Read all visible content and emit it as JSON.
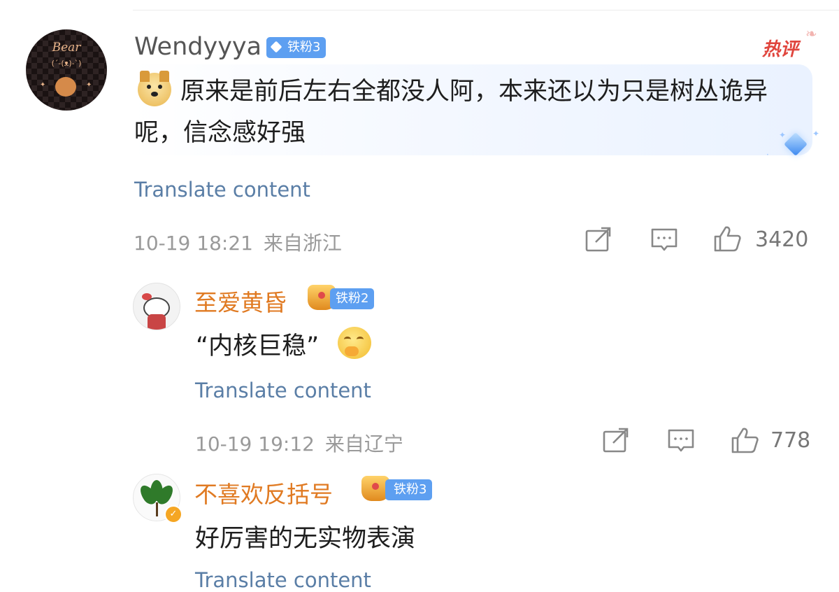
{
  "main_comment": {
    "username": "Wendyyya",
    "fan_badge": "铁粉3",
    "hot_badge": "热评",
    "text": "原来是前后左右全都没人阿，本来还以为只是树丛诡异呢，信念感好强",
    "translate_label": "Translate content",
    "timestamp": "10-19 18:21",
    "location": "来自浙江",
    "like_count": "3420",
    "avatar_text": "Bear",
    "avatar_face": "(´-(ᴥ)-`)"
  },
  "replies": [
    {
      "username": "至爱黄昏",
      "fan_badge": "铁粉2",
      "text": "“内核巨稳”",
      "translate_label": "Translate content",
      "timestamp": "10-19 19:12",
      "location": "来自辽宁",
      "like_count": "778"
    },
    {
      "username": "不喜欢反括号",
      "fan_badge": "铁粉3",
      "text": "好厉害的无实物表演",
      "translate_label": "Translate content"
    }
  ],
  "colors": {
    "username_reply": "#e07a22",
    "link": "#5a7ea6",
    "badge": "#5d9ff1",
    "hot": "#e0453d"
  },
  "icons": [
    "share-icon",
    "comment-icon",
    "like-icon",
    "doge-emoji",
    "thinking-emoji",
    "crown-icon",
    "diamond-icon",
    "verified-icon"
  ]
}
